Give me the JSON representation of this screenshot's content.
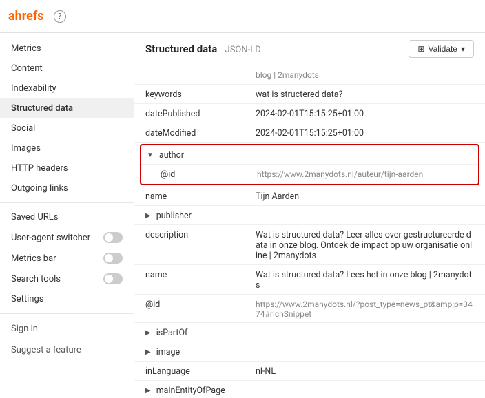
{
  "app": {
    "name": "ahrefs",
    "logo_text": "ahrefs"
  },
  "sidebar": {
    "items": [
      {
        "id": "metrics",
        "label": "Metrics",
        "active": false,
        "toggle": null
      },
      {
        "id": "content",
        "label": "Content",
        "active": false,
        "toggle": null
      },
      {
        "id": "indexability",
        "label": "Indexability",
        "active": false,
        "toggle": null
      },
      {
        "id": "structured-data",
        "label": "Structured data",
        "active": true,
        "toggle": null
      },
      {
        "id": "social",
        "label": "Social",
        "active": false,
        "toggle": null
      },
      {
        "id": "images",
        "label": "Images",
        "active": false,
        "toggle": null
      },
      {
        "id": "http-headers",
        "label": "HTTP headers",
        "active": false,
        "toggle": null
      },
      {
        "id": "outgoing-links",
        "label": "Outgoing links",
        "active": false,
        "toggle": null
      },
      {
        "id": "saved-urls",
        "label": "Saved URLs",
        "active": false,
        "toggle": null
      },
      {
        "id": "user-agent-switcher",
        "label": "User-agent switcher",
        "active": false,
        "toggle": "off"
      },
      {
        "id": "metrics-bar",
        "label": "Metrics bar",
        "active": false,
        "toggle": "off"
      },
      {
        "id": "search-tools",
        "label": "Search tools",
        "active": false,
        "toggle": "off"
      },
      {
        "id": "settings",
        "label": "Settings",
        "active": false,
        "toggle": null
      }
    ],
    "sign_in": "Sign in",
    "suggest_feature": "Suggest a feature"
  },
  "content": {
    "title": "Structured data",
    "subtitle": "JSON-LD",
    "validate_label": "Validate",
    "rows": [
      {
        "id": "breadcrumb-url",
        "key": "",
        "value": "blog | 2manydots",
        "indent": 0,
        "type": "value",
        "expand": false
      },
      {
        "id": "keywords",
        "key": "keywords",
        "value": "wat is structered data?",
        "indent": 0,
        "type": "value",
        "expand": false
      },
      {
        "id": "datePublished",
        "key": "datePublished",
        "value": "2024-02-01T15:15:25+01:00",
        "indent": 0,
        "type": "value",
        "expand": false
      },
      {
        "id": "dateModified",
        "key": "dateModified",
        "value": "2024-02-01T15:15:25+01:00",
        "indent": 0,
        "type": "value",
        "expand": false
      },
      {
        "id": "author",
        "key": "author",
        "value": "",
        "indent": 0,
        "type": "expand",
        "expand": true,
        "open": true,
        "highlighted": true
      },
      {
        "id": "author-id",
        "key": "@id",
        "value": "https://www.2manydots.nl/auteur/tijn-aarden",
        "indent": 1,
        "type": "link",
        "expand": false,
        "highlighted": true
      },
      {
        "id": "name-author",
        "key": "name",
        "value": "Tijn Aarden",
        "indent": 0,
        "type": "value",
        "expand": false
      },
      {
        "id": "publisher",
        "key": "publisher",
        "value": "",
        "indent": 0,
        "type": "expand",
        "expand": true,
        "open": false
      },
      {
        "id": "description",
        "key": "description",
        "value": "Wat is structured data? Leer alles over gestructureerde data in onze blog. Ontdek de impact op uw organisatie online | 2manydots",
        "indent": 0,
        "type": "value",
        "expand": false
      },
      {
        "id": "name-main",
        "key": "name",
        "value": "Wat is structured data? Lees het in onze blog | 2manydots",
        "indent": 0,
        "type": "value",
        "expand": false
      },
      {
        "id": "main-id",
        "key": "@id",
        "value": "https://www.2manydots.nl/?post_type=news_pt&amp;p=3474#richSnippet",
        "indent": 0,
        "type": "link",
        "expand": false
      },
      {
        "id": "isPartOf",
        "key": "isPartOf",
        "value": "",
        "indent": 0,
        "type": "expand",
        "expand": true,
        "open": false
      },
      {
        "id": "image",
        "key": "image",
        "value": "",
        "indent": 0,
        "type": "expand",
        "expand": true,
        "open": false
      },
      {
        "id": "inLanguage",
        "key": "inLanguage",
        "value": "nl-NL",
        "indent": 0,
        "type": "value",
        "expand": false
      },
      {
        "id": "mainEntityOfPage",
        "key": "mainEntityOfPage",
        "value": "",
        "indent": 0,
        "type": "expand",
        "expand": true,
        "open": false
      }
    ]
  }
}
